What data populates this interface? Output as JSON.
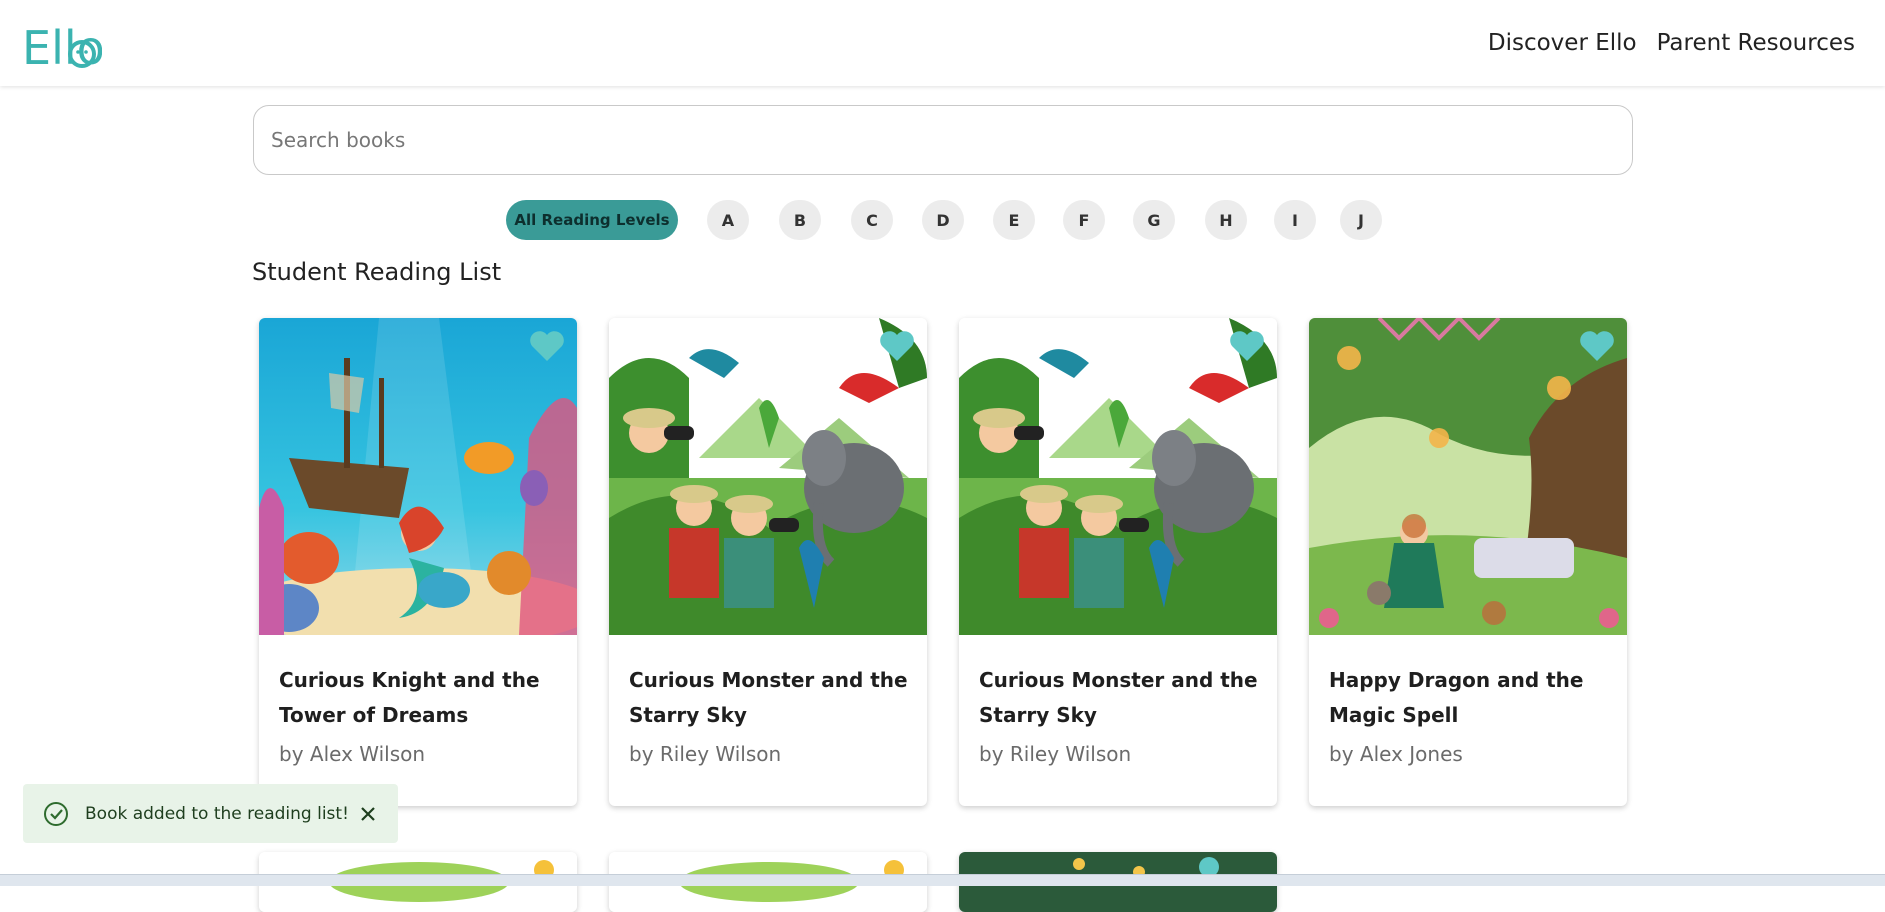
{
  "header": {
    "logo_text": "Ello",
    "nav": [
      "Discover Ello",
      "Parent Resources"
    ]
  },
  "search": {
    "placeholder": "Search books",
    "value": ""
  },
  "levels": {
    "all_label": "All Reading Levels",
    "letters": [
      "A",
      "B",
      "C",
      "D",
      "E",
      "F",
      "G",
      "H",
      "I",
      "J"
    ],
    "selected": "All Reading Levels"
  },
  "section_title": "Student Reading List",
  "books": [
    {
      "title": "Curious Knight and the Tower of Dreams",
      "author": "by Alex Wilson",
      "theme": "underwater"
    },
    {
      "title": "Curious Monster and the Starry Sky",
      "author": "by Riley Wilson",
      "theme": "jungle"
    },
    {
      "title": "Curious Monster and the Starry Sky",
      "author": "by Riley Wilson",
      "theme": "jungle"
    },
    {
      "title": "Happy Dragon and the Magic Spell",
      "author": "by Alex Jones",
      "theme": "garden"
    }
  ],
  "toast": {
    "message": "Book added to the reading list!"
  },
  "colors": {
    "brand": "#3bb3b0",
    "level_selected": "#3a9b97",
    "heart": "#5ec8c6",
    "toast_bg": "#e8f3e8"
  }
}
